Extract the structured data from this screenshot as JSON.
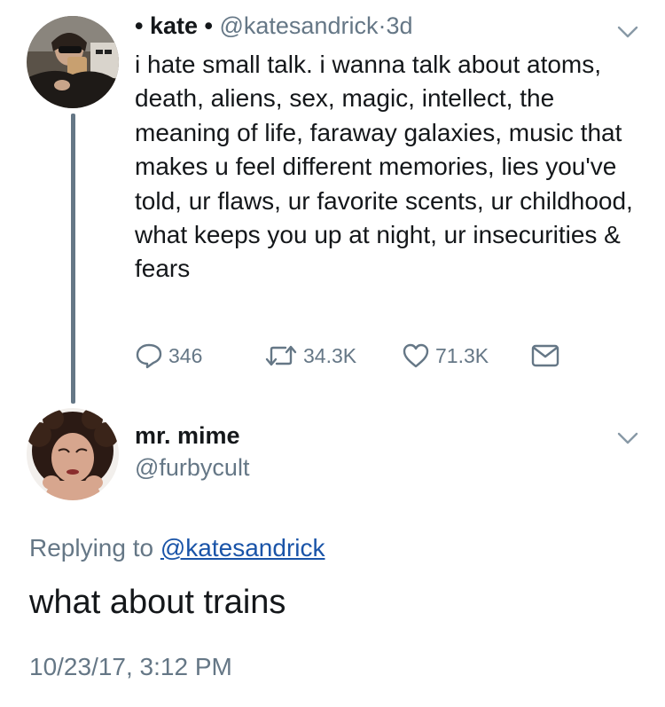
{
  "tweet": {
    "name_prefix": "• kate •",
    "handle": "@katesandrick",
    "sep": "·",
    "time": "3d",
    "text": "i hate small talk. i wanna talk about atoms, death, aliens, sex, magic, intellect, the meaning of life, faraway galaxies, music that makes u feel different memories, lies you've told, ur flaws, ur favorite scents, ur childhood, what keeps you up at night, ur insecurities & fears",
    "reply_count": "346",
    "retweet_count": "34.3K",
    "like_count": "71.3K",
    "icons": {
      "reply": "speech-bubble-icon",
      "retweet": "retweet-icon",
      "like": "heart-icon",
      "dm": "envelope-icon",
      "menu": "chevron-down-icon"
    }
  },
  "reply": {
    "name": "mr. mime",
    "handle": "@furbycult",
    "replying_label": "Replying to",
    "replying_handle": "@katesandrick",
    "text": "what about trains",
    "timestamp": "10/23/17, 3:12 PM"
  },
  "colors": {
    "text": "#14171a",
    "secondary": "#657786",
    "link": "#1a54a8"
  }
}
